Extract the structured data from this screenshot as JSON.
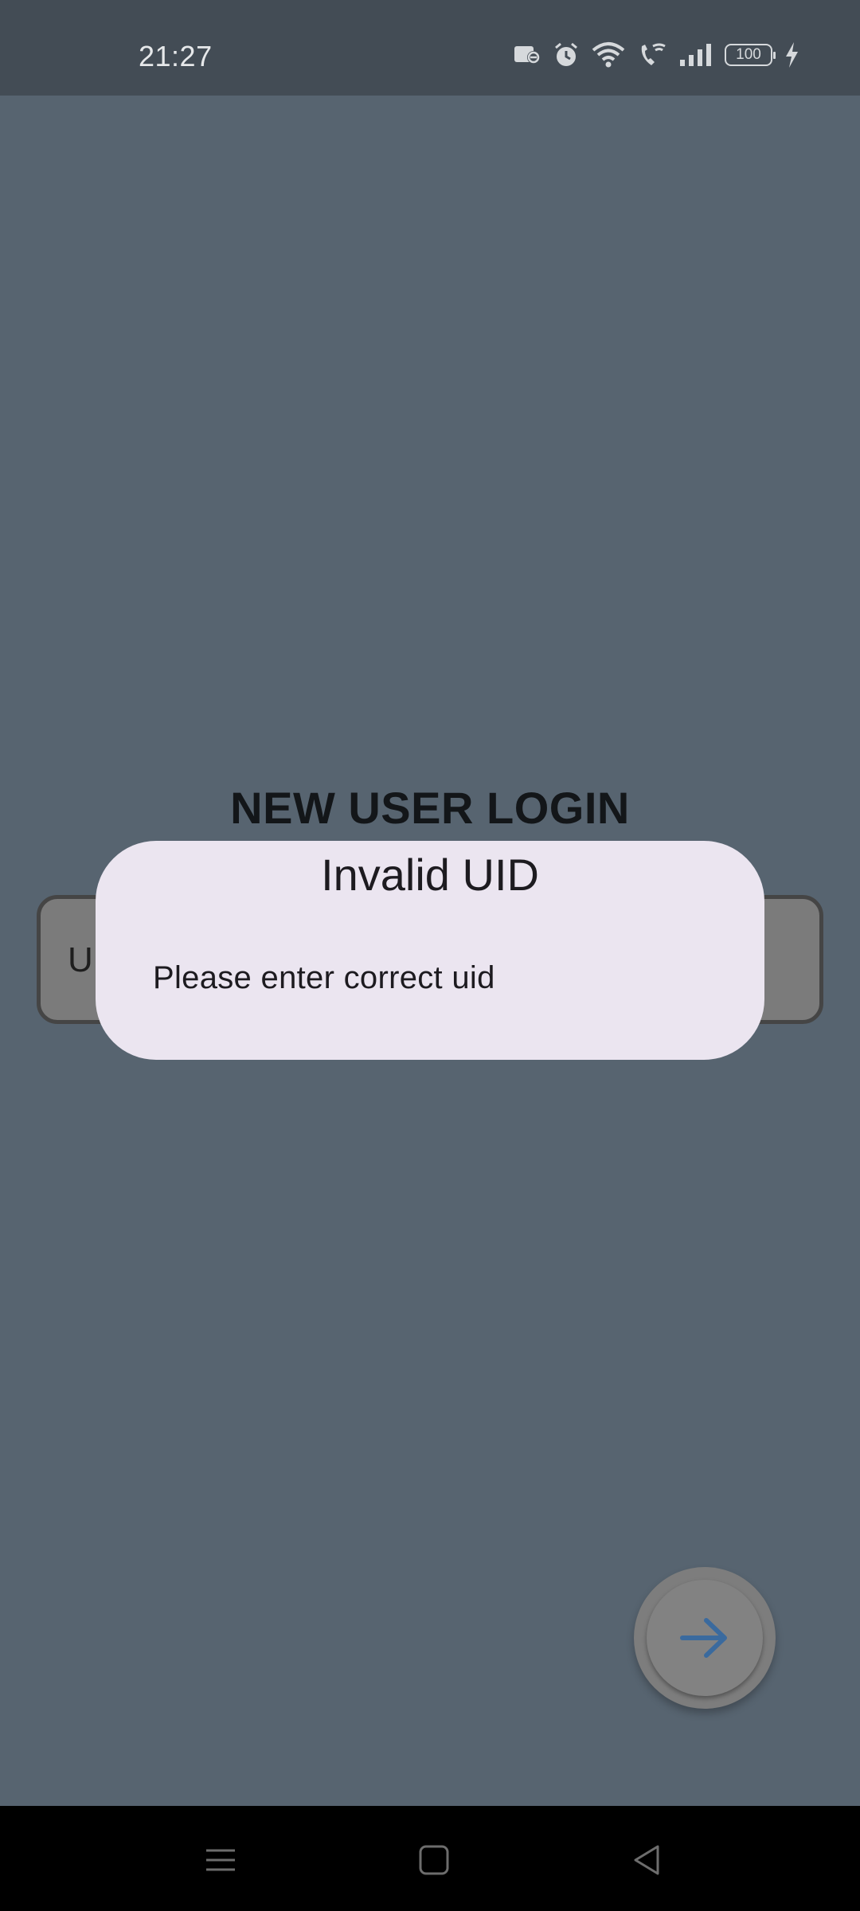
{
  "status_bar": {
    "time": "21:27",
    "battery_level": "100",
    "icons": [
      "sim-card-icon",
      "alarm-icon",
      "wifi-icon",
      "wifi-calling-icon",
      "signal-icon",
      "battery-icon",
      "charging-icon"
    ]
  },
  "page": {
    "title": "NEW USER LOGIN",
    "uid_field_text": "UID",
    "next_button_icon": "arrow-right-icon"
  },
  "dialog": {
    "title": "Invalid UID",
    "message": "Please enter correct uid"
  },
  "nav_bar": {
    "icons": [
      "menu-icon",
      "home-icon",
      "back-icon"
    ]
  },
  "colors": {
    "scrim_background": "#576470",
    "status_bar": "#434c55",
    "dialog_surface": "#ebe5f0",
    "fab_arrow": "#3a6a9e"
  }
}
